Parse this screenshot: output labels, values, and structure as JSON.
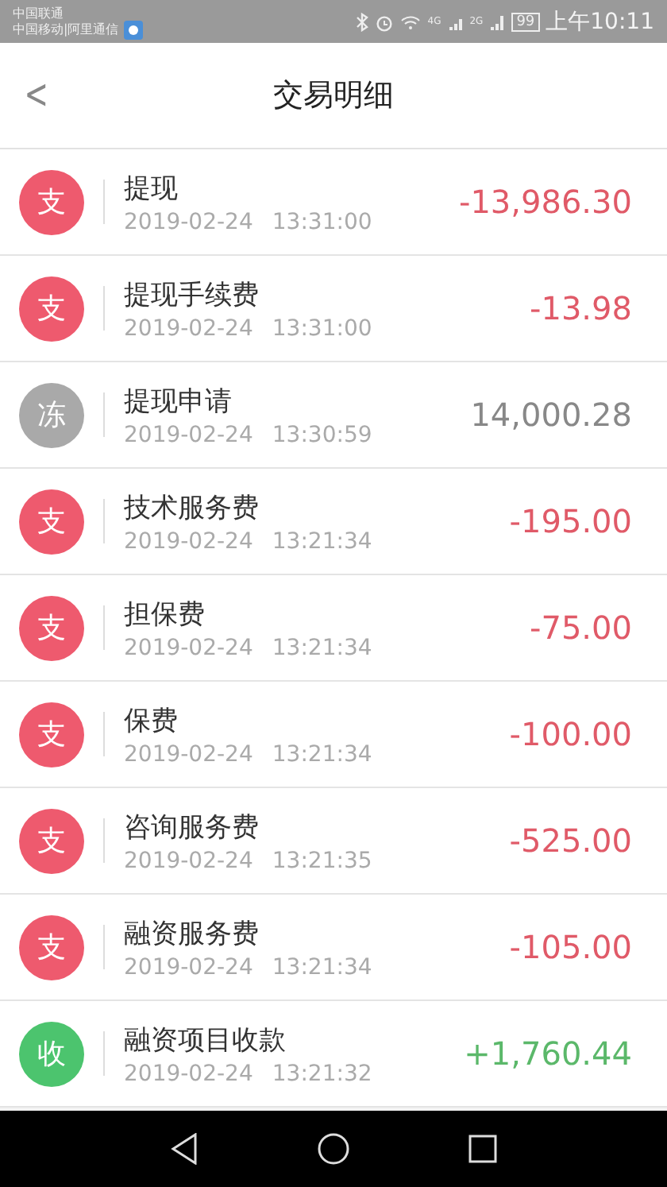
{
  "status_bar": {
    "carriers": [
      "中国联通",
      "中国移动|阿里通信"
    ],
    "network_labels": [
      "4G",
      "2G"
    ],
    "battery": "99",
    "time": "上午10:11"
  },
  "header": {
    "back": "<",
    "title": "交易明细"
  },
  "transactions": [
    {
      "kind": "expense",
      "badge": "支",
      "color": "#ee5a6e",
      "name": "提现",
      "date": "2019-02-24",
      "time": "13:31:00",
      "amount": "-13,986.30"
    },
    {
      "kind": "expense",
      "badge": "支",
      "color": "#ee5a6e",
      "name": "提现手续费",
      "date": "2019-02-24",
      "time": "13:31:00",
      "amount": "-13.98"
    },
    {
      "kind": "frozen",
      "badge": "冻",
      "color": "#a9a9a9",
      "name": "提现申请",
      "date": "2019-02-24",
      "time": "13:30:59",
      "amount": "14,000.28"
    },
    {
      "kind": "expense",
      "badge": "支",
      "color": "#ee5a6e",
      "name": "技术服务费",
      "date": "2019-02-24",
      "time": "13:21:34",
      "amount": "-195.00"
    },
    {
      "kind": "expense",
      "badge": "支",
      "color": "#ee5a6e",
      "name": "担保费",
      "date": "2019-02-24",
      "time": "13:21:34",
      "amount": "-75.00"
    },
    {
      "kind": "expense",
      "badge": "支",
      "color": "#ee5a6e",
      "name": "保费",
      "date": "2019-02-24",
      "time": "13:21:34",
      "amount": "-100.00"
    },
    {
      "kind": "expense",
      "badge": "支",
      "color": "#ee5a6e",
      "name": "咨询服务费",
      "date": "2019-02-24",
      "time": "13:21:35",
      "amount": "-525.00"
    },
    {
      "kind": "expense",
      "badge": "支",
      "color": "#ee5a6e",
      "name": "融资服务费",
      "date": "2019-02-24",
      "time": "13:21:34",
      "amount": "-105.00"
    },
    {
      "kind": "income",
      "badge": "收",
      "color": "#4cc46e",
      "name": "融资项目收款",
      "date": "2019-02-24",
      "time": "13:21:32",
      "amount": "+1,760.44"
    }
  ]
}
